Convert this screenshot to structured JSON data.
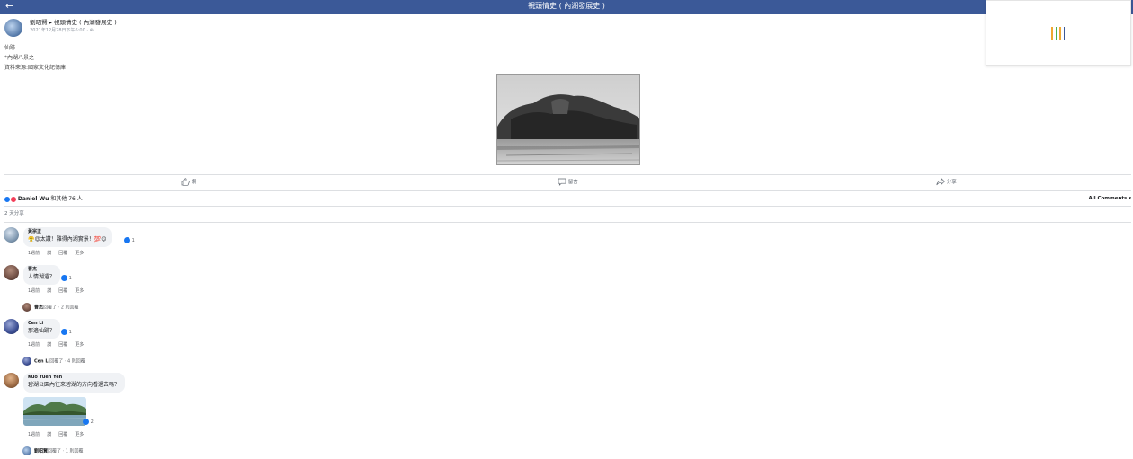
{
  "topbar": {
    "back_icon": "←",
    "title": "視頭情史 ( 內湖發展史 )"
  },
  "loader": {
    "colors": [
      "#f0a830",
      "#4caf50",
      "#f0a830",
      "#3b5998"
    ]
  },
  "post": {
    "author": "劉昭賢 ▸ 視頭情史 ( 內湖發展史 )",
    "meta": "2021年12月28日下午6:00 · ⊕",
    "body": [
      "仙跡",
      "*內湖八景之一",
      "資料來源:國家文化記憶庫"
    ]
  },
  "actions": {
    "like": "讚",
    "comment": "留言",
    "share": "分享"
  },
  "reactions": {
    "names": "Daniel Wu",
    "others": "和其他 76 人"
  },
  "all_comments": "All Comments ▾",
  "minutes": "2 天分享",
  "comments": [
    {
      "name": "黃宗正",
      "text": "😤😍太讚！難得內湖實景！💯😊",
      "likes": "1",
      "time": "1週前",
      "like": "讚",
      "reply": "回覆",
      "more": "更多"
    },
    {
      "name": "曹杰",
      "text": "人情湖遺？",
      "likes": "1",
      "time": "1週前",
      "like": "讚",
      "reply": "回覆",
      "more": "更多",
      "reply_by": "曹杰",
      "reply_text": "回覆了 · 2 則回覆"
    },
    {
      "name": "Cen Li",
      "text": "那邊仙跡？",
      "likes": "1",
      "time": "1週前",
      "like": "讚",
      "reply": "回覆",
      "more": "更多",
      "reply_by": "Cen Li",
      "reply_text": "回覆了 · 4 則回覆"
    },
    {
      "name": "Kuo Yuen Yeh",
      "text": "碧湖公園內往來碧湖的方向看過去嗎？",
      "likes": "2",
      "time": "1週前",
      "like": "讚",
      "reply": "回覆",
      "more": "更多",
      "reply_by": "劉昭賢",
      "reply_text": "回覆了 · 1 則回覆"
    }
  ]
}
